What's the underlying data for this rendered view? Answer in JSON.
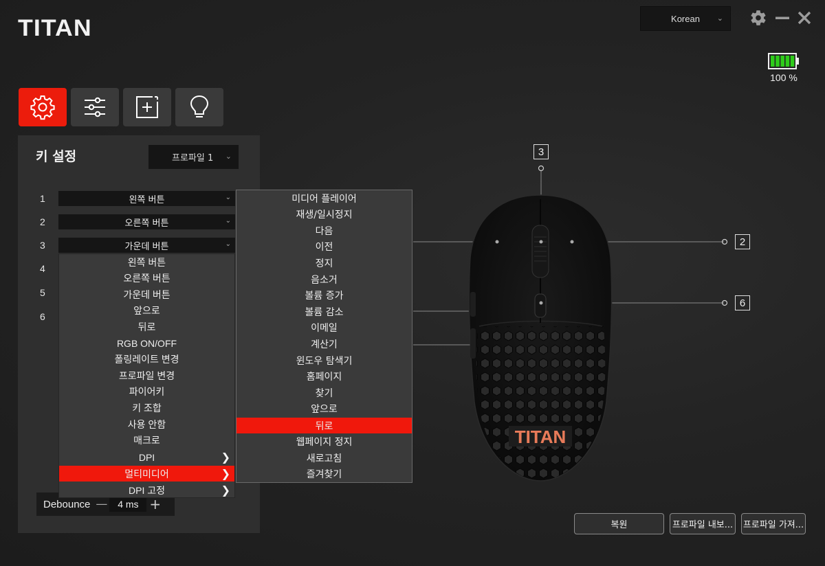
{
  "app": {
    "logo": "TITAN"
  },
  "header": {
    "language": "Korean",
    "battery_percent": "100 %",
    "battery_level": 1.0
  },
  "tabs": [
    {
      "icon": "gear-icon",
      "active": true
    },
    {
      "icon": "sliders-icon",
      "active": false
    },
    {
      "icon": "macro-add-icon",
      "active": false
    },
    {
      "icon": "lightbulb-icon",
      "active": false
    }
  ],
  "panel": {
    "title": "키 설정",
    "profile": "프로파일 1",
    "rows": [
      {
        "num": "1",
        "value": "왼쪽 버튼"
      },
      {
        "num": "2",
        "value": "오른쪽 버튼"
      },
      {
        "num": "3",
        "value": "가운데 버튼"
      },
      {
        "num": "4"
      },
      {
        "num": "5"
      },
      {
        "num": "6"
      }
    ]
  },
  "dropdown": {
    "items": [
      "왼쪽 버튼",
      "오른쪽 버튼",
      "가운데 버튼",
      "앞으로",
      "뒤로",
      "RGB ON/OFF",
      "폴링레이트 변경",
      "프로파일 변경",
      "파이어키",
      "키 조합",
      "사용 안함",
      "매크로",
      "DPI",
      "멀티미디어",
      "DPI 고정"
    ],
    "selected": "멀티미디어"
  },
  "submenu": {
    "items": [
      "미디어 플레이어",
      "재생/일시정지",
      "다음",
      "이전",
      "정지",
      "음소거",
      "볼륨 증가",
      "볼륨 감소",
      "이메일",
      "계산기",
      "윈도우 탐색기",
      "홈페이지",
      "찾기",
      "앞으로",
      "뒤로",
      "웹페이지 정지",
      "새로고침",
      "즐겨찾기"
    ],
    "selected": "뒤로"
  },
  "debounce": {
    "label": "Debounce",
    "value": "4 ms"
  },
  "mouse": {
    "callouts": [
      "3",
      "2",
      "6"
    ],
    "logo": "TITAN"
  },
  "buttons": {
    "restore": "복원",
    "export": "프로파일 내보...",
    "import": "프로파일 가져..."
  },
  "colors": {
    "accent": "#ec1c0c",
    "background": "#232323",
    "panel": "#2f2f2f",
    "battery": "#2ecc1a"
  }
}
